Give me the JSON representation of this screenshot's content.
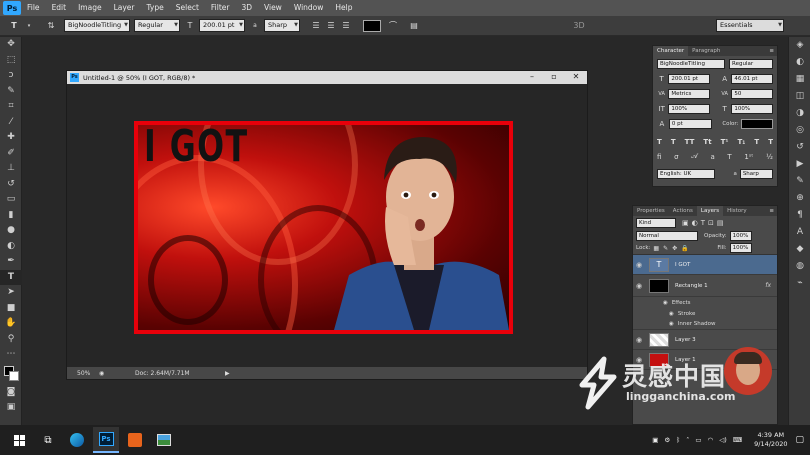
{
  "menu": {
    "app_logo": "Ps",
    "items": [
      "File",
      "Edit",
      "Image",
      "Layer",
      "Type",
      "Select",
      "Filter",
      "3D",
      "View",
      "Window",
      "Help"
    ]
  },
  "options": {
    "tool_icon": "T",
    "font_family": "BigNoodleTitling",
    "font_style": "Regular",
    "font_size": "200.01 pt",
    "aa_label": "a",
    "aa_method": "Sharp",
    "three_d": "3D",
    "workspace": "Essentials"
  },
  "document": {
    "title": "Untitled-1 @ 50% (I GOT, RGB/8) *",
    "zoom": "50%",
    "doc_size": "Doc: 2.64M/7.71M",
    "headline": "I GOT"
  },
  "character": {
    "tabs": [
      "Character",
      "Paragraph"
    ],
    "font_family": "BigNoodleTitling",
    "font_style": "Regular",
    "size": "200.01 pt",
    "leading": "46.01 pt",
    "kerning": "Metrics",
    "tracking": "50",
    "vscale": "100%",
    "hscale": "100%",
    "baseline": "0 pt",
    "color_label": "Color:",
    "language": "English: UK",
    "aa": "Sharp"
  },
  "layers": {
    "tabs": [
      "Properties",
      "Actions",
      "Layers",
      "History"
    ],
    "kind": "Kind",
    "blend_mode": "Normal",
    "opacity_label": "Opacity:",
    "opacity": "100%",
    "lock_label": "Lock:",
    "fill_label": "Fill:",
    "fill": "100%",
    "items": [
      {
        "name": "I GOT",
        "type": "text",
        "selected": true
      },
      {
        "name": "Rectangle 1",
        "type": "shape",
        "fx": "fx"
      },
      {
        "name": "Effects",
        "type": "effects"
      },
      {
        "name": "Stroke",
        "type": "effect"
      },
      {
        "name": "Inner Shadow",
        "type": "effect"
      },
      {
        "name": "Layer 3",
        "type": "raster"
      },
      {
        "name": "Layer 1",
        "type": "raster"
      }
    ]
  },
  "watermark": {
    "text": "灵感中国",
    "url": "lingganchina.com"
  },
  "taskbar": {
    "time": "4:39 AM",
    "date": "9/14/2020",
    "apps": [
      "start",
      "task-view",
      "edge",
      "photoshop",
      "app-orange",
      "photos"
    ]
  },
  "colors": {
    "accent": "#31a8ff",
    "frame_red": "#e8000a",
    "selected_layer": "#4b6a8f"
  }
}
